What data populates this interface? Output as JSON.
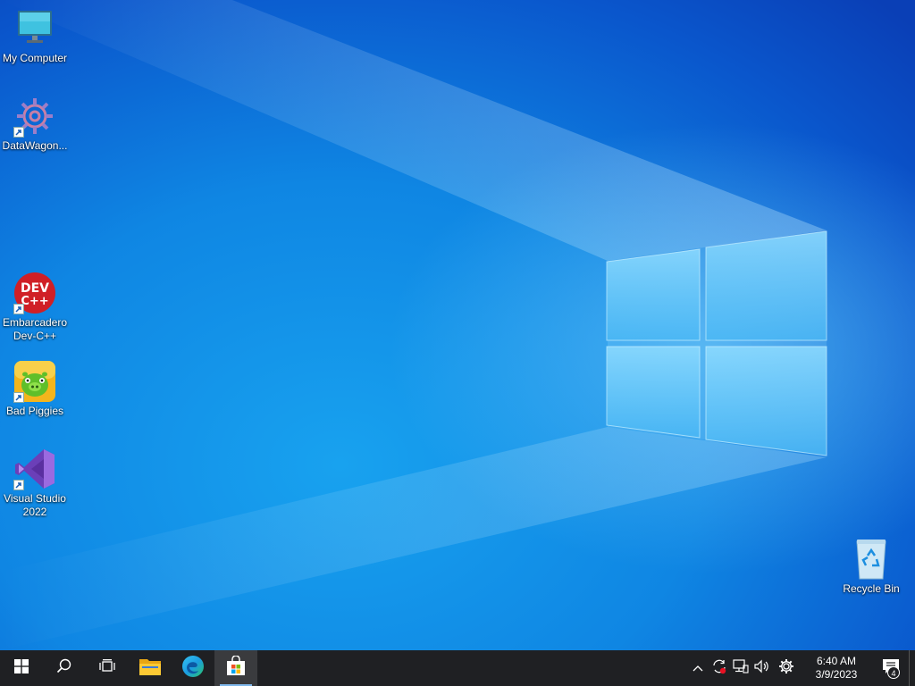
{
  "desktop": {
    "icons": [
      {
        "id": "my-computer",
        "label": "My Computer"
      },
      {
        "id": "datawagon",
        "label": "DataWagon..."
      },
      {
        "id": "dev-cpp",
        "label": "Embarcadero Dev-C++",
        "icon_text": "DEV C++"
      },
      {
        "id": "bad-piggies",
        "label": "Bad Piggies"
      },
      {
        "id": "visual-studio",
        "label": "Visual Studio 2022"
      },
      {
        "id": "recycle-bin",
        "label": "Recycle Bin"
      }
    ]
  },
  "taskbar": {
    "buttons": [
      {
        "id": "start",
        "icon": "windows-logo-icon"
      },
      {
        "id": "search",
        "icon": "search-icon"
      },
      {
        "id": "task-view",
        "icon": "task-view-icon"
      },
      {
        "id": "file-explorer",
        "icon": "folder-icon"
      },
      {
        "id": "edge",
        "icon": "edge-icon"
      },
      {
        "id": "store",
        "icon": "store-icon",
        "active": true
      }
    ],
    "tray": {
      "icons": [
        "chevron-up-icon",
        "sync-icon",
        "network-icon",
        "volume-icon",
        "settings-icon"
      ],
      "time": "6:40 AM",
      "date": "3/9/2023",
      "notification_count": "4"
    }
  },
  "colors": {
    "taskbar_bg": "#1f2023",
    "desktop_blue": "#0f86e3",
    "accent": "#7fb8ec"
  }
}
